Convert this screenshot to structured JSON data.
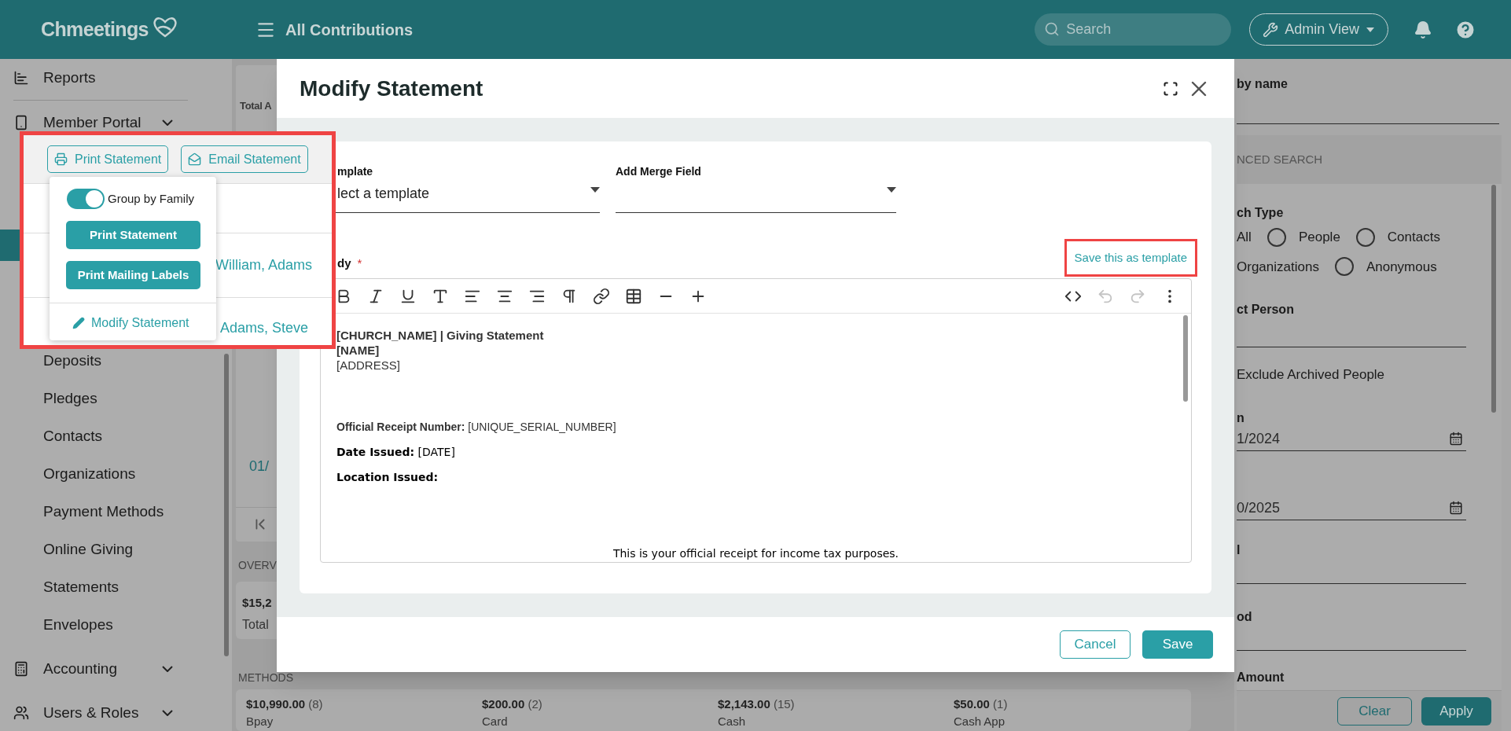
{
  "header": {
    "logo": "Chmeetings",
    "title": "All Contributions",
    "search": {
      "placeholder": "Search"
    },
    "view_button": "Admin View"
  },
  "sidebar": {
    "items": [
      {
        "kind": "reports",
        "label": "Reports",
        "selected": false,
        "expandable": false,
        "divider_after": true
      },
      {
        "kind": "portal",
        "label": "Member Portal",
        "selected": false,
        "expandable": true
      },
      {
        "kind": "hidden",
        "selected": true
      },
      {
        "kind": "plain",
        "label": "Deposits",
        "selected": false
      },
      {
        "kind": "plain",
        "label": "Pledges",
        "selected": false
      },
      {
        "kind": "plain",
        "label": "Contacts",
        "selected": false
      },
      {
        "kind": "plain",
        "label": "Organizations",
        "selected": false
      },
      {
        "kind": "plain",
        "label": "Payment Methods",
        "selected": false
      },
      {
        "kind": "plain",
        "label": "Online Giving",
        "selected": false
      },
      {
        "kind": "plain",
        "label": "Statements",
        "selected": false
      },
      {
        "kind": "plain",
        "label": "Envelopes",
        "selected": false
      },
      {
        "kind": "accounting",
        "label": "Accounting",
        "selected": false,
        "expandable": true
      },
      {
        "kind": "users",
        "label": "Users & Roles",
        "selected": false,
        "expandable": true
      }
    ]
  },
  "main": {
    "heading": "Total A",
    "row_date": "01/",
    "overview_label": "OVERV",
    "overview_card": {
      "amount": "$15,2",
      "label": "Total"
    },
    "methods_label": "METHODS",
    "methods": [
      {
        "amount": "$10,990.00",
        "count": "(8)",
        "name": "Bpay"
      },
      {
        "amount": "$200.00",
        "count": "(2)",
        "name": "Card"
      },
      {
        "amount": "$2,143.00",
        "count": "(15)",
        "name": "Cash"
      },
      {
        "amount": "$50.00",
        "count": "(1)",
        "name": "Cash App"
      }
    ]
  },
  "statement_popup": {
    "toolbar_buttons": [
      {
        "kind": "print",
        "label": "Print Statement"
      },
      {
        "kind": "email",
        "label": "Email Statement"
      }
    ],
    "rows": [
      {
        "name": "William, Adams"
      },
      {
        "name": "Adams, Steve"
      }
    ],
    "menu": {
      "toggle": {
        "label": "Group by Family",
        "on": true
      },
      "buttons": [
        "Print Statement",
        "Print Mailing Labels"
      ],
      "link": "Modify Statement"
    }
  },
  "modal": {
    "title": "Modify Statement",
    "template": {
      "label": "mplate",
      "value": "lect a template"
    },
    "merge_field": {
      "label": "Add Merge Field"
    },
    "body_label": "dy",
    "required_mark": "*",
    "save_template_link": "Save this as template",
    "toolbar_left": [
      {
        "kind": "bold",
        "disabled": false
      },
      {
        "kind": "italic",
        "disabled": false
      },
      {
        "kind": "underline",
        "disabled": false
      },
      {
        "kind": "font_size",
        "disabled": false
      },
      {
        "kind": "align_left",
        "disabled": false
      },
      {
        "kind": "align_center",
        "disabled": false
      },
      {
        "kind": "align_right",
        "disabled": false
      },
      {
        "kind": "paragraph",
        "disabled": false
      },
      {
        "kind": "link",
        "disabled": false
      },
      {
        "kind": "table",
        "disabled": false
      },
      {
        "kind": "rule",
        "disabled": false
      },
      {
        "kind": "insert",
        "disabled": false
      }
    ],
    "toolbar_right": [
      {
        "kind": "code",
        "disabled": false
      },
      {
        "kind": "undo",
        "disabled": true
      },
      {
        "kind": "redo",
        "disabled": true
      },
      {
        "kind": "more",
        "disabled": false
      }
    ],
    "content": [
      {
        "kind": "title",
        "text": "[CHURCH_NAME] | Giving Statement"
      },
      {
        "kind": "title",
        "text": "[NAME]"
      },
      {
        "kind": "plain",
        "text": "[ADDRESS]"
      },
      {
        "kind": "field",
        "text": "**Official Receipt Number:** [UNIQUE_SERIAL_NUMBER]"
      },
      {
        "kind": "field_wide",
        "text": "**Date Issued:** [DATE]"
      },
      {
        "kind": "field_wide",
        "text": "**Location Issued:**"
      },
      {
        "kind": "centered",
        "text": "This is your official receipt for income tax purposes."
      }
    ],
    "buttons": {
      "cancel": "Cancel",
      "save": "Save"
    }
  },
  "filter_panel": {
    "search_label": "by name",
    "advanced_title": "NCED SEARCH",
    "type_label": "ch Type",
    "types": [
      {
        "label": "All"
      },
      {
        "label": "People",
        "selected": false
      },
      {
        "label": "Contacts",
        "selected": false
      },
      {
        "label": "Organizations"
      },
      {
        "label": "Anonymous",
        "selected": false
      }
    ],
    "person_label": "ct Person",
    "exclude_label": "Exclude Archived People",
    "from": {
      "label": "n",
      "value": "1/2024"
    },
    "to": {
      "value": "0/2025"
    },
    "field_3": {
      "label": "l"
    },
    "field_4": {
      "label": "od"
    },
    "amount_label": "Amount",
    "buttons": [
      "Clear",
      "Apply"
    ]
  }
}
